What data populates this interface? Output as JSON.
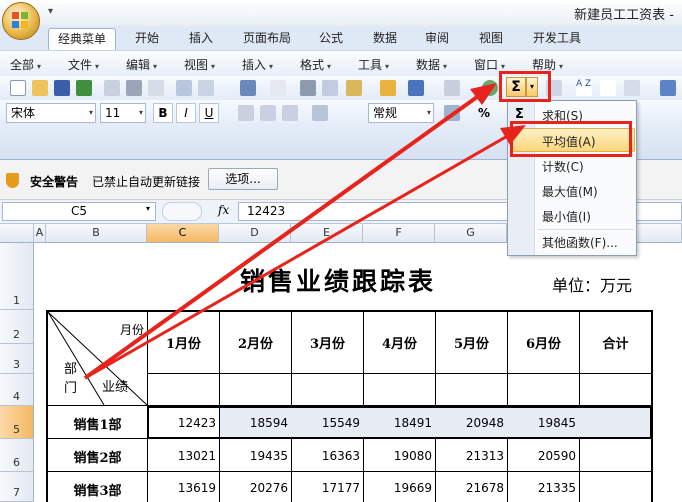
{
  "window": {
    "title": "新建员工工资表 -"
  },
  "tabs": [
    "经典菜单",
    "开始",
    "插入",
    "页面布局",
    "公式",
    "数据",
    "审阅",
    "视图",
    "开发工具"
  ],
  "menus": [
    "全部",
    "文件",
    "编辑",
    "视图",
    "插入",
    "格式",
    "工具",
    "数据",
    "窗口",
    "帮助"
  ],
  "toolbar": {
    "font_name": "宋体",
    "font_size": "11",
    "bold": "B",
    "italic": "I",
    "underline": "U",
    "number_format": "常规",
    "percent": "%",
    "sigma": "Σ",
    "sort": "A Z"
  },
  "security": {
    "title": "安全警告",
    "message": "已禁止自动更新链接",
    "options_button": "选项..."
  },
  "formula_bar": {
    "name_box": "C5",
    "fx": "fx",
    "value": "12423"
  },
  "columns": [
    "A",
    "B",
    "C",
    "D",
    "E",
    "F",
    "G"
  ],
  "rows": [
    "1",
    "2",
    "3",
    "4",
    "5",
    "6",
    "7"
  ],
  "sheet": {
    "title": "销售业绩跟踪表",
    "unit": "单位：万元",
    "corner_month": "月份",
    "corner_dept": "部",
    "corner_dept2": "门",
    "corner_perf": "业绩",
    "month_headers": [
      "1月份",
      "2月份",
      "3月份",
      "4月份",
      "5月份",
      "6月份",
      "合计"
    ],
    "data_rows": [
      {
        "dept": "销售1部",
        "values": [
          "12423",
          "18594",
          "15549",
          "18491",
          "20948",
          "19845"
        ]
      },
      {
        "dept": "销售2部",
        "values": [
          "13021",
          "19435",
          "16363",
          "19080",
          "21313",
          "20590"
        ]
      },
      {
        "dept": "销售3部",
        "values": [
          "13619",
          "20276",
          "17177",
          "19669",
          "21678",
          "21335"
        ]
      }
    ]
  },
  "autosum_menu": {
    "items": [
      "求和(S)",
      "平均值(A)",
      "计数(C)",
      "最大值(M)",
      "最小值(I)",
      "其他函数(F)..."
    ],
    "highlighted": "平均值(A)"
  },
  "colors": {
    "highlight_red": "#e8231c",
    "selection_orange": "#f4b963",
    "ribbon_blue": "#dfe8f5"
  }
}
